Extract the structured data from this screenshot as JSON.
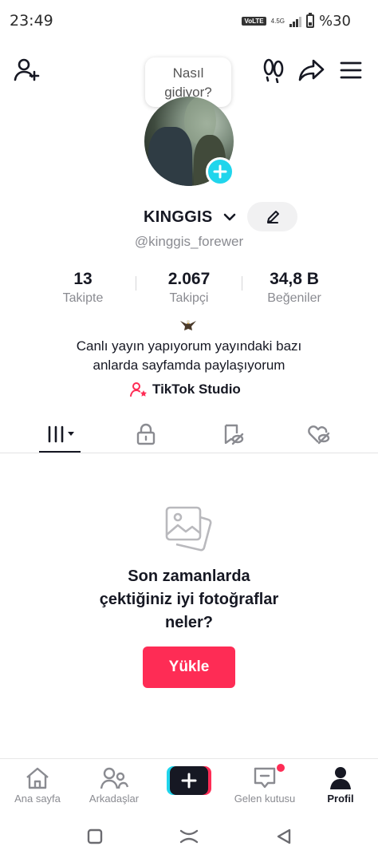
{
  "status_bar": {
    "time": "23:49",
    "volte": "VoLTE",
    "network": "4.5G",
    "battery": "%30"
  },
  "header": {
    "bubble_line1": "Nasıl",
    "bubble_line2": "gidiyor?"
  },
  "profile": {
    "username": "KINGGIS",
    "handle": "@kinggis_forewer",
    "stats": [
      {
        "value": "13",
        "label": "Takipte"
      },
      {
        "value": "2.067",
        "label": "Takipçi"
      },
      {
        "value": "34,8 B",
        "label": "Beğeniler"
      }
    ],
    "bio_line1": "Canlı yayın yapıyorum yayındaki bazı",
    "bio_line2": "anlarda sayfamda paylaşıyorum",
    "studio_label": "TikTok Studio"
  },
  "empty_state": {
    "title_line1": "Son zamanlarda",
    "title_line2": "çektiğiniz iyi fotoğraflar",
    "title_line3": "neler?",
    "upload_label": "Yükle"
  },
  "bottom_nav": {
    "home": "Ana sayfa",
    "friends": "Arkadaşlar",
    "inbox": "Gelen kutusu",
    "profile": "Profil"
  },
  "colors": {
    "accent": "#fe2c55",
    "cyan": "#20d5ec",
    "text": "#161823",
    "muted": "#8a8b91"
  },
  "icons": [
    "add-friend-icon",
    "footprint-icon",
    "share-icon",
    "menu-icon",
    "plus-icon",
    "chevron-down-icon",
    "edit-icon",
    "eagle-emoji",
    "studio-icon",
    "grid-icon",
    "lock-icon",
    "saved-icon",
    "liked-icon",
    "photo-icon",
    "home-icon",
    "friends-icon",
    "create-icon",
    "inbox-icon",
    "profile-icon"
  ]
}
